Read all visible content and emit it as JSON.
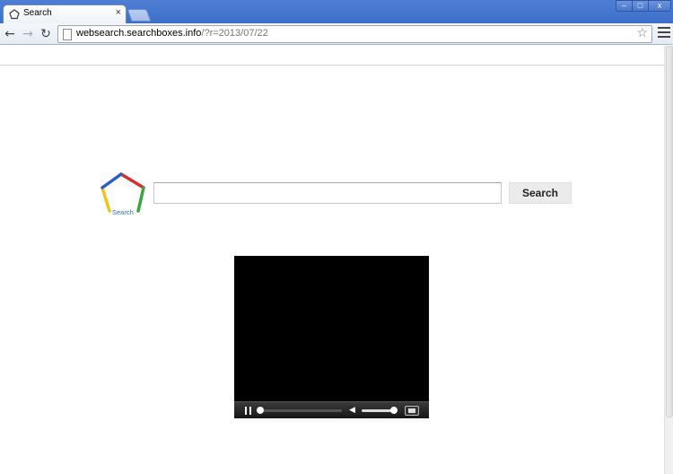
{
  "browser": {
    "tab_title": "Search",
    "tab_close": "×",
    "window_buttons": {
      "minimize": "–",
      "maximize": "□",
      "close": "x"
    },
    "nav": {
      "back": "←",
      "forward": "→",
      "reload": "↻"
    },
    "url_host": "websearch.searchboxes.info",
    "url_path": "/?r=2013/07/22",
    "star": "☆"
  },
  "page": {
    "logo_text": "Search",
    "search": {
      "value": "",
      "placeholder": "",
      "button_label": "Search"
    },
    "logo_colors": {
      "top": "#d0312d",
      "right": "#3aa541",
      "bottom": "#f0c419",
      "left": "#2a5fcf"
    }
  },
  "video_player": {
    "state": "paused",
    "progress": 0,
    "volume": 1.0,
    "volume_icon": "◀"
  }
}
